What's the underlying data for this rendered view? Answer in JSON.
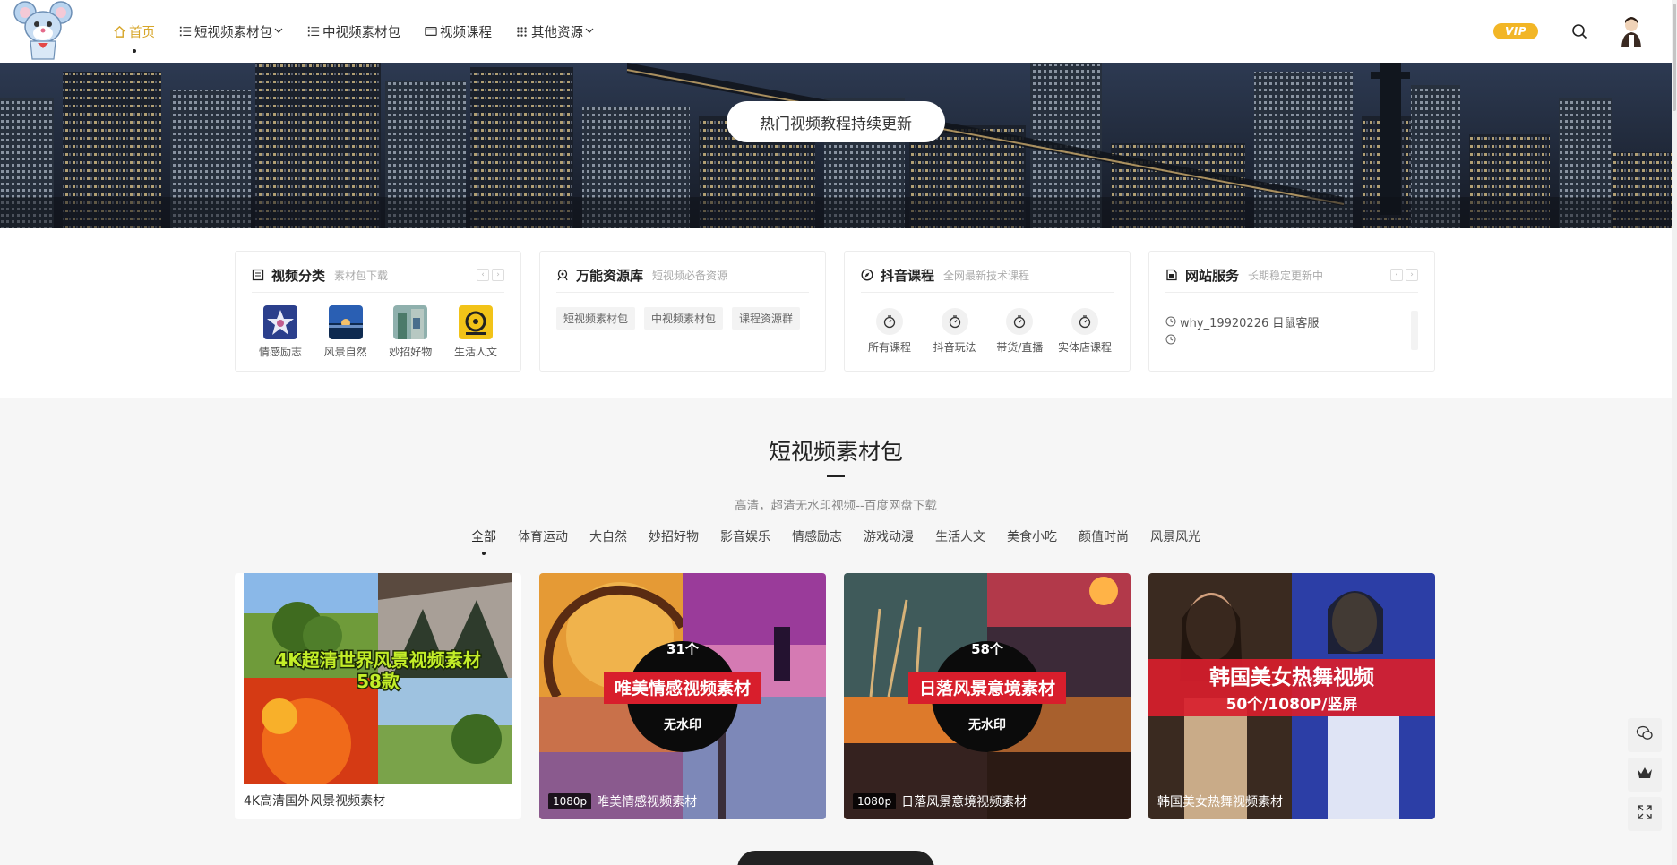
{
  "nav": {
    "items": [
      {
        "label": "首页",
        "icon": "home-icon",
        "active": true
      },
      {
        "label": "短视频素材包",
        "icon": "list-icon",
        "dropdown": true
      },
      {
        "label": "中视频素材包",
        "icon": "list-icon"
      },
      {
        "label": "视频课程",
        "icon": "video-icon"
      },
      {
        "label": "其他资源",
        "icon": "grid-icon",
        "dropdown": true
      }
    ],
    "vip_label": "VIP",
    "accent": "#d7a62a"
  },
  "banner": {
    "button_label": "热门视频教程持续更新"
  },
  "widgets": {
    "categories": {
      "title": "视频分类",
      "subtitle": "素材包下载",
      "items": [
        {
          "label": "情感励志"
        },
        {
          "label": "风景自然"
        },
        {
          "label": "妙招好物"
        },
        {
          "label": "生活人文"
        }
      ]
    },
    "resources": {
      "title": "万能资源库",
      "subtitle": "短视频必备资源",
      "tags": [
        "短视频素材包",
        "中视频素材包",
        "课程资源群"
      ]
    },
    "douyin": {
      "title": "抖音课程",
      "subtitle": "全网最新技术课程",
      "items": [
        {
          "label": "所有课程"
        },
        {
          "label": "抖音玩法"
        },
        {
          "label": "带货/直播"
        },
        {
          "label": "实体店课程"
        }
      ]
    },
    "service": {
      "title": "网站服务",
      "subtitle": "长期稳定更新中",
      "lines": [
        "why_19920226 目鼠客服",
        ""
      ]
    }
  },
  "section": {
    "title": "短视频素材包",
    "subtitle": "高清，超清无水印视频--百度网盘下载",
    "filters": [
      "全部",
      "体育运动",
      "大自然",
      "妙招好物",
      "影音娱乐",
      "情感励志",
      "游戏动漫",
      "生活人文",
      "美食小吃",
      "颜值时尚",
      "风景风光"
    ]
  },
  "cards": [
    {
      "title": "4K高清国外风景视频素材",
      "resolution": "",
      "overlay_line1": "4K超清世界风景视频素材",
      "overlay_line2": "58款"
    },
    {
      "title": "唯美情感视频素材",
      "resolution": "1080p",
      "overlay_count": "31个",
      "overlay_main": "唯美情感视频素材",
      "overlay_sub": "无水印"
    },
    {
      "title": "日落风景意境视频素材",
      "resolution": "1080p",
      "overlay_count": "58个",
      "overlay_main": "日落风景意境素材",
      "overlay_sub": "无水印"
    },
    {
      "title": "韩国美女热舞视频素材",
      "resolution": "",
      "overlay_main": "韩国美女热舞视频",
      "overlay_sub": "50个/1080P/竖屏"
    }
  ]
}
